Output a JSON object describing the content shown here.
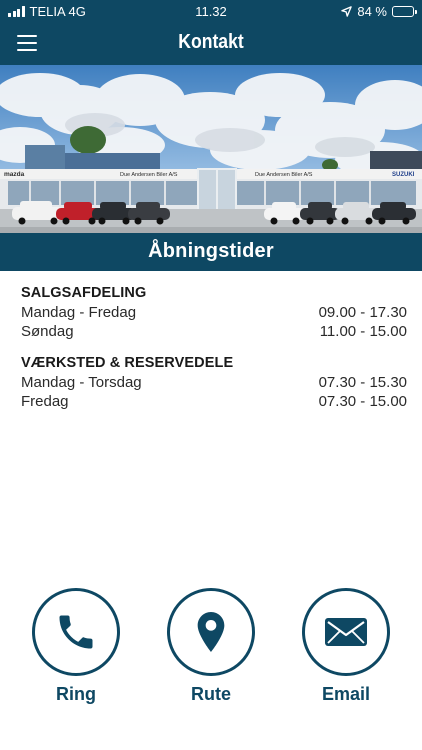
{
  "status_bar": {
    "carrier": "TELIA 4G",
    "time": "11.32",
    "battery_percent": "84 %",
    "battery_level": 0.84
  },
  "header": {
    "title": "Kontakt",
    "menu_icon": "hamburger-menu-icon"
  },
  "hero": {
    "description_icon": "dealership-photo",
    "sign_left": "Due Andersen Biler A/S",
    "sign_right": "Due Andersen Biler A/S",
    "brand_left": "mazda",
    "brand_right": "SUZUKI"
  },
  "section": {
    "title": "Åbningstider"
  },
  "hours": [
    {
      "department": "SALGSAFDELING",
      "rows": [
        {
          "day": "Mandag - Fredag",
          "time": "09.00 - 17.30"
        },
        {
          "day": "Søndag",
          "time": "11.00 - 15.00"
        }
      ]
    },
    {
      "department": "VÆRKSTED & RESERVEDELE",
      "rows": [
        {
          "day": "Mandag - Torsdag",
          "time": "07.30 - 15.30"
        },
        {
          "day": "Fredag",
          "time": "07.30 - 15.00"
        }
      ]
    }
  ],
  "actions": [
    {
      "label": "Ring",
      "icon": "phone-icon"
    },
    {
      "label": "Rute",
      "icon": "map-pin-icon"
    },
    {
      "label": "Email",
      "icon": "envelope-icon"
    }
  ],
  "colors": {
    "brand": "#0e4863",
    "text": "#1f1f1f",
    "background": "#ffffff"
  }
}
